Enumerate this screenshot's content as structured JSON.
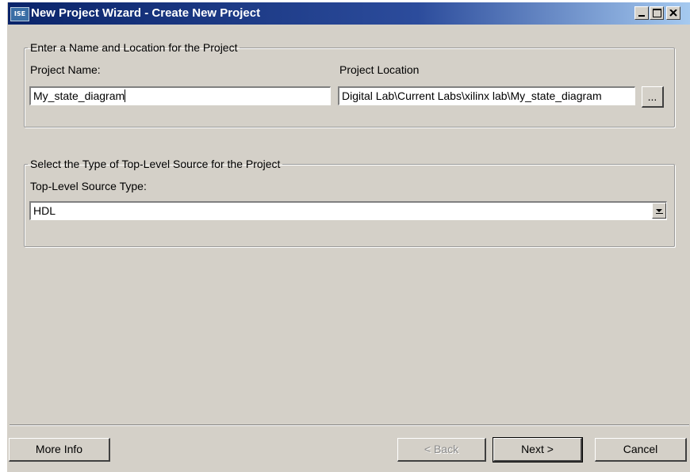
{
  "window": {
    "app_icon": "ISE",
    "title": "New Project Wizard - Create New Project",
    "controls": [
      "minimize-icon",
      "maximize-icon",
      "close-icon"
    ]
  },
  "name_location_group": {
    "legend": "Enter a Name and Location for the Project",
    "project_name_label": "Project Name:",
    "project_name_value": "My_state_diagram",
    "project_location_label": "Project Location",
    "project_location_value": "Digital Lab\\Current Labs\\xilinx lab\\My_state_diagram",
    "browse_label": "..."
  },
  "source_type_group": {
    "legend": "Select the Type of Top-Level Source for the Project",
    "source_type_label": "Top-Level Source Type:",
    "source_type_value": "HDL"
  },
  "footer": {
    "more_info_label": "More Info",
    "back_label": "< Back",
    "next_label": "Next >",
    "cancel_label": "Cancel"
  }
}
